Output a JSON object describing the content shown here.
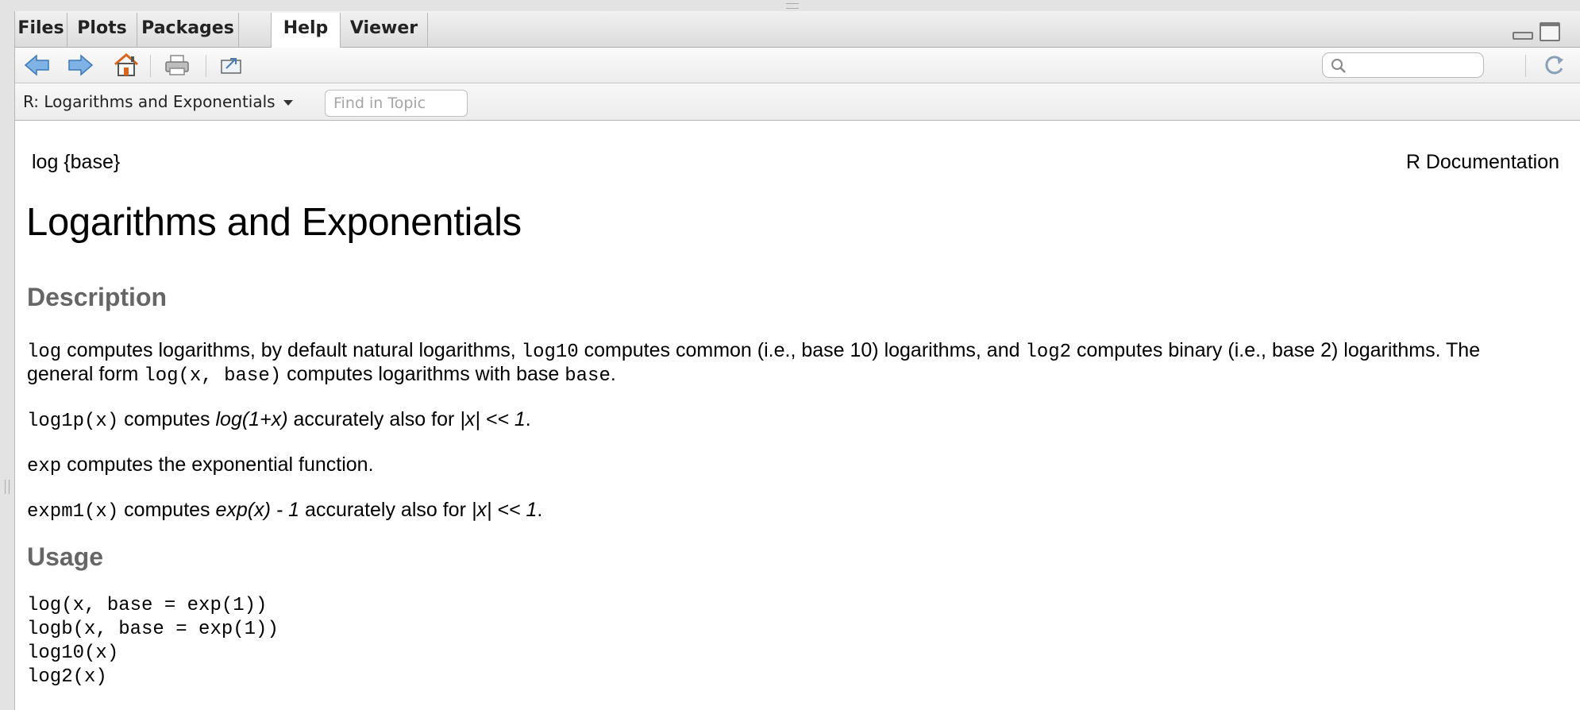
{
  "tabs": [
    {
      "label": "Files",
      "active": false
    },
    {
      "label": "Plots",
      "active": false
    },
    {
      "label": "Packages",
      "active": false
    },
    {
      "label": "Help",
      "active": true
    },
    {
      "label": "Viewer",
      "active": false
    }
  ],
  "toolbar": {
    "icons": [
      "back-arrow-icon",
      "forward-arrow-icon",
      "home-icon",
      "print-icon",
      "open-in-window-icon",
      "search-icon",
      "refresh-icon"
    ],
    "search_value": ""
  },
  "topic_bar": {
    "topic": "R: Logarithms and Exponentials",
    "find_placeholder": "Find in Topic"
  },
  "doc": {
    "header_left": "log {base}",
    "header_right": "R Documentation",
    "title": "Logarithms and Exponentials",
    "description_heading": "Description",
    "p1": {
      "c1": "log",
      "t1": " computes logarithms, by default natural logarithms, ",
      "c2": "log10",
      "t2": " computes common (i.e., base 10) logarithms, and ",
      "c3": "log2",
      "t3": " computes binary (i.e., base 2) logarithms. The"
    },
    "p1b": {
      "t1": "general form ",
      "c1": "log(x, base)",
      "t2": " computes logarithms with base ",
      "c2": "base",
      "t3": "."
    },
    "p2": {
      "c1": "log1p(x)",
      "t1": " computes ",
      "i1": "log(1+x)",
      "t2": " accurately also for ",
      "i2": "|x| << 1",
      "t3": "."
    },
    "p3": {
      "c1": "exp",
      "t1": " computes the exponential function."
    },
    "p4": {
      "c1": "expm1(x)",
      "t1": " computes ",
      "i1": "exp(x) - 1",
      "t2": " accurately also for ",
      "i2": "|x| << 1",
      "t3": "."
    },
    "usage_heading": "Usage",
    "usage_lines": [
      "log(x, base = exp(1))",
      "logb(x, base = exp(1))",
      "log10(x)",
      "log2(x)"
    ]
  },
  "colors": {
    "section_heading": "#666666",
    "arrow_blue": "#5b9bd5",
    "home_orange": "#e8812a"
  }
}
